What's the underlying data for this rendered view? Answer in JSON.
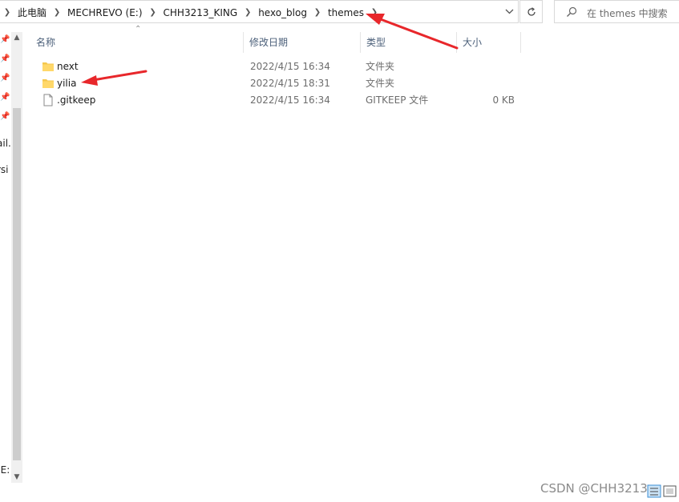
{
  "address_bar": {
    "breadcrumbs": [
      "此电脑",
      "MECHREVO (E:)",
      "CHH3213_KING",
      "hexo_blog",
      "themes"
    ],
    "dropdown_icon": "chevron-down-icon",
    "refresh_icon": "refresh-icon"
  },
  "search": {
    "placeholder": "在 themes 中搜索",
    "icon": "search-icon"
  },
  "nav_pane": {
    "pins": [
      "pin-icon",
      "pin-icon",
      "pin-icon",
      "pin-icon",
      "pin-icon"
    ],
    "partial_labels": [
      "ail.",
      "rsi",
      "(E:"
    ]
  },
  "columns": [
    "名称",
    "修改日期",
    "类型",
    "大小"
  ],
  "files": [
    {
      "name": "next",
      "modified": "2022/4/15 16:34",
      "type": "文件夹",
      "size": "",
      "icon": "folder-icon"
    },
    {
      "name": "yilia",
      "modified": "2022/4/15 18:31",
      "type": "文件夹",
      "size": "",
      "icon": "folder-icon"
    },
    {
      "name": ".gitkeep",
      "modified": "2022/4/15 16:34",
      "type": "GITKEEP 文件",
      "size": "0 KB",
      "icon": "file-icon"
    }
  ],
  "watermark": "CSDN @CHH3213",
  "annotation_color": "#e8272b"
}
